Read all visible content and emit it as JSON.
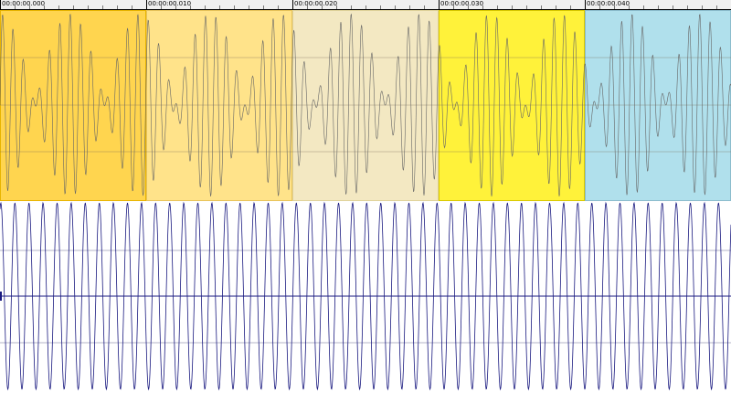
{
  "ruler": {
    "labels": [
      "00:00:00.000",
      "00:00:00.010",
      "00:00:00.020",
      "00:00:00.030",
      "00:00:00.040"
    ]
  },
  "top_track": {
    "segments": [
      {
        "color": "#ffd54f",
        "border": "#e8b400"
      },
      {
        "color": "#ffe38a",
        "border": "#e8c35a"
      },
      {
        "color": "#f3e8c2",
        "border": "#e0d29a"
      },
      {
        "color": "#fff23a",
        "border": "#d8c800"
      },
      {
        "color": "#b0e0ec",
        "border": "#8bbccc"
      }
    ]
  },
  "colors": {
    "ruler_bg": "#f0f0f0",
    "waveform_top": "#666666",
    "waveform_bottom": "#1a1a80",
    "centerline": "#1a1a80",
    "gridline": "#b4b4c8"
  }
}
